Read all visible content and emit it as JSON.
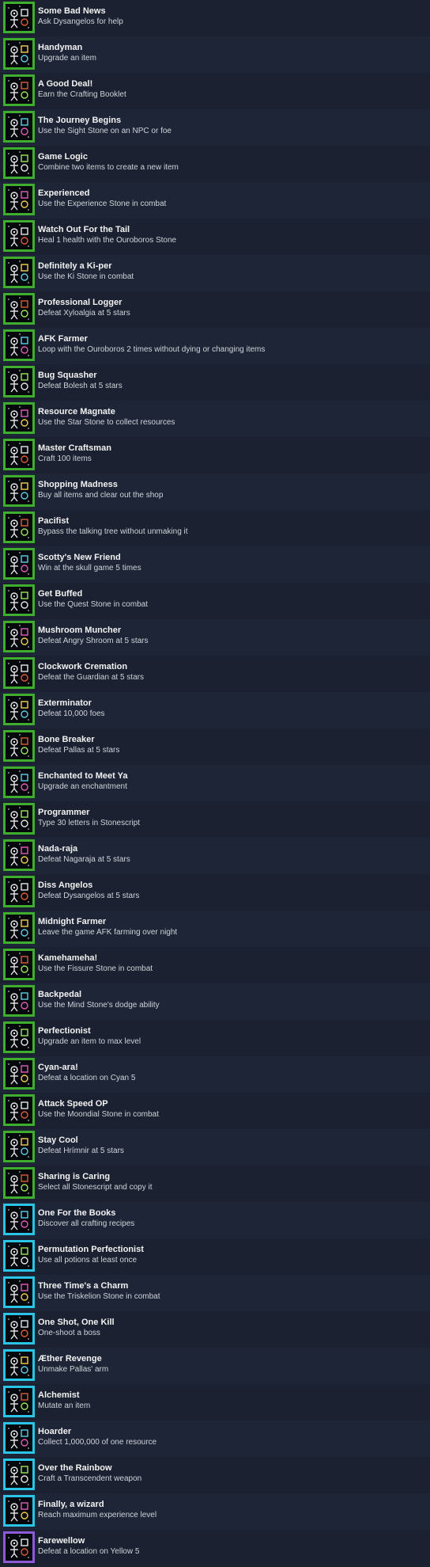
{
  "achievements": [
    {
      "title": "Some Bad News",
      "desc": "Ask Dysangelos for help",
      "tier": "green",
      "icon": "bad-news-icon"
    },
    {
      "title": "Handyman",
      "desc": "Upgrade an item",
      "tier": "green",
      "icon": "hammer-icon"
    },
    {
      "title": "A Good Deal!",
      "desc": "Earn the Crafting Booklet",
      "tier": "green",
      "icon": "booklet-icon"
    },
    {
      "title": "The Journey Begins",
      "desc": "Use the Sight Stone on an NPC or foe",
      "tier": "green",
      "icon": "eye-icon"
    },
    {
      "title": "Game Logic",
      "desc": "Combine two items to create a new item",
      "tier": "green",
      "icon": "combine-icon"
    },
    {
      "title": "Experienced",
      "desc": "Use the Experience Stone in combat",
      "tier": "green",
      "icon": "experience-stone-icon"
    },
    {
      "title": "Watch Out For the Tail",
      "desc": "Heal 1 health with the Ouroboros Stone",
      "tier": "green",
      "icon": "ouroboros-icon"
    },
    {
      "title": "Definitely a Ki-per",
      "desc": "Use the Ki Stone in combat",
      "tier": "green",
      "icon": "ki-stone-icon"
    },
    {
      "title": "Professional Logger",
      "desc": "Defeat Xyloalgia at 5 stars",
      "tier": "green",
      "icon": "logger-icon"
    },
    {
      "title": "AFK Farmer",
      "desc": "Loop with the Ouroboros 2 times without dying or changing items",
      "tier": "green",
      "icon": "sleeping-icon"
    },
    {
      "title": "Bug Squasher",
      "desc": "Defeat Bolesh at 5 stars",
      "tier": "green",
      "icon": "bug-icon"
    },
    {
      "title": "Resource Magnate",
      "desc": "Use the Star Stone to collect resources",
      "tier": "green",
      "icon": "star-stone-icon"
    },
    {
      "title": "Master Craftsman",
      "desc": "Craft 100 items",
      "tier": "green",
      "icon": "anvil-icon"
    },
    {
      "title": "Shopping Madness",
      "desc": "Buy all items and clear out the shop",
      "tier": "green",
      "icon": "shop-icon"
    },
    {
      "title": "Pacifist",
      "desc": "Bypass the talking tree without unmaking it",
      "tier": "green",
      "icon": "pacifist-icon"
    },
    {
      "title": "Scotty's New Friend",
      "desc": "Win at the skull game 5 times",
      "tier": "green",
      "icon": "skull-game-icon"
    },
    {
      "title": "Get Buffed",
      "desc": "Use the Quest Stone in combat",
      "tier": "green",
      "icon": "buff-icon"
    },
    {
      "title": "Mushroom Muncher",
      "desc": "Defeat Angry Shroom at 5 stars",
      "tier": "green",
      "icon": "mushroom-icon"
    },
    {
      "title": "Clockwork Cremation",
      "desc": "Defeat the Guardian at 5 stars",
      "tier": "green",
      "icon": "clockwork-icon"
    },
    {
      "title": "Exterminator",
      "desc": "Defeat 10,000 foes",
      "tier": "green",
      "icon": "exterminator-icon"
    },
    {
      "title": "Bone Breaker",
      "desc": "Defeat Pallas at 5 stars",
      "tier": "green",
      "icon": "bone-icon"
    },
    {
      "title": "Enchanted to Meet Ya",
      "desc": "Upgrade an enchantment",
      "tier": "green",
      "icon": "enchant-icon"
    },
    {
      "title": "Programmer",
      "desc": "Type 30 letters in Stonescript",
      "tier": "green",
      "icon": "code-icon"
    },
    {
      "title": "Nada-raja",
      "desc": "Defeat Nagaraja at 5 stars",
      "tier": "green",
      "icon": "nagaraja-icon"
    },
    {
      "title": "Diss Angelos",
      "desc": "Defeat Dysangelos at 5 stars",
      "tier": "green",
      "icon": "dysangelos-icon"
    },
    {
      "title": "Midnight Farmer",
      "desc": "Leave the game AFK farming over night",
      "tier": "green",
      "icon": "night-icon"
    },
    {
      "title": "Kamehameha!",
      "desc": "Use the Fissure Stone in combat",
      "tier": "green",
      "icon": "fissure-icon"
    },
    {
      "title": "Backpedal",
      "desc": "Use the Mind Stone's dodge ability",
      "tier": "green",
      "icon": "dodge-icon"
    },
    {
      "title": "Perfectionist",
      "desc": "Upgrade an item to max level",
      "tier": "green",
      "icon": "sword-icon"
    },
    {
      "title": "Cyan-ara!",
      "desc": "Defeat a location on Cyan 5",
      "tier": "green",
      "icon": "mountain-icon"
    },
    {
      "title": "Attack Speed OP",
      "desc": "Use the Moondial Stone in combat",
      "tier": "green",
      "icon": "speed-icon"
    },
    {
      "title": "Stay Cool",
      "desc": "Defeat Hrímnir at 5 stars",
      "tier": "green",
      "icon": "frost-icon"
    },
    {
      "title": "Sharing is Caring",
      "desc": "Select all Stonescript and copy it",
      "tier": "green",
      "icon": "copy-icon"
    },
    {
      "title": "One For the Books",
      "desc": "Discover all crafting recipes",
      "tier": "cyan",
      "icon": "book-icon"
    },
    {
      "title": "Permutation Perfectionist",
      "desc": "Use all potions at least once",
      "tier": "cyan",
      "icon": "potion-icon"
    },
    {
      "title": "Three Time's a Charm",
      "desc": "Use the Triskelion Stone in combat",
      "tier": "cyan",
      "icon": "triskelion-icon"
    },
    {
      "title": "One Shot, One Kill",
      "desc": "One-shoot a boss",
      "tier": "cyan",
      "icon": "crossbow-icon"
    },
    {
      "title": "Æther Revenge",
      "desc": "Unmake Pallas' arm",
      "tier": "cyan",
      "icon": "aether-icon"
    },
    {
      "title": "Alchemist",
      "desc": "Mutate an item",
      "tier": "cyan",
      "icon": "moon-icon"
    },
    {
      "title": "Hoarder",
      "desc": "Collect 1,000,000 of one resource",
      "tier": "cyan",
      "icon": "hoard-icon"
    },
    {
      "title": "Over the Rainbow",
      "desc": "Craft a Transcendent weapon",
      "tier": "cyan",
      "icon": "rainbow-icon"
    },
    {
      "title": "Finally, a wizard",
      "desc": "Reach maximum experience level",
      "tier": "cyan",
      "icon": "wizard-icon"
    },
    {
      "title": "Farewellow",
      "desc": "Defeat a location on Yellow 5",
      "tier": "purple",
      "icon": "boat-icon"
    }
  ],
  "colors": {
    "green": "#3fae2f",
    "cyan": "#29c4e6",
    "purple": "#8e5ad8",
    "title": "#f2f2f2",
    "desc": "#cfd3da",
    "row_odd": "#1b2130",
    "row_even": "#1e2536"
  }
}
